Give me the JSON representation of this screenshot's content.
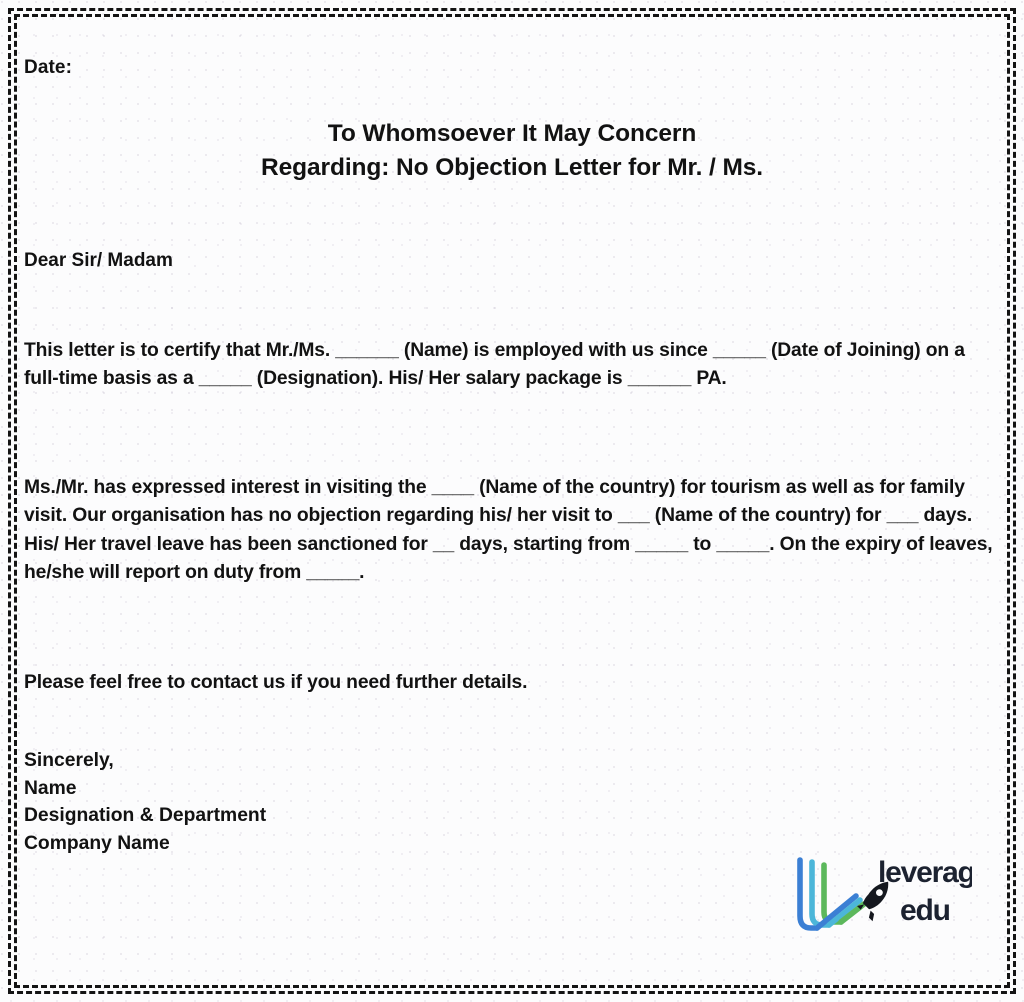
{
  "document": {
    "type": "letter-template",
    "date_label": "Date:",
    "title_lines": [
      "To Whomsoever It May Concern",
      "Regarding: No Objection Letter for Mr. / Ms."
    ],
    "salutation": "Dear Sir/ Madam",
    "paragraphs": [
      "This letter is to certify that Mr./Ms. ______ (Name) is employed with us since _____ (Date of Joining) on a full-time basis as a _____ (Designation). His/ Her salary package is ______ PA.",
      "Ms./Mr. has expressed interest in visiting the ____ (Name of the country) for tourism as well as for family visit. Our organisation has no objection regarding his/ her visit to ___ (Name of the country) for ___ days. His/ Her travel leave has been sanctioned for __ days, starting from _____ to _____. On the expiry of leaves, he/she will report on duty from _____.",
      "Please feel free to contact us if you need further details."
    ],
    "signature_block": [
      "Sincerely,",
      "Name",
      "Designation & Department",
      "Company Name"
    ]
  },
  "logo": {
    "word_top": "leverage",
    "word_bottom": "edu",
    "icon": "rocket-icon",
    "colors": {
      "stroke_outer_blue": "#3b7fd4",
      "stroke_middle_cyan": "#4cb6d9",
      "stroke_inner_green": "#5cb85c",
      "wordmark": "#1c2230"
    }
  },
  "theme": {
    "page_background": "#fcfcfd",
    "text_color": "#121212",
    "border_color": "#141414"
  }
}
